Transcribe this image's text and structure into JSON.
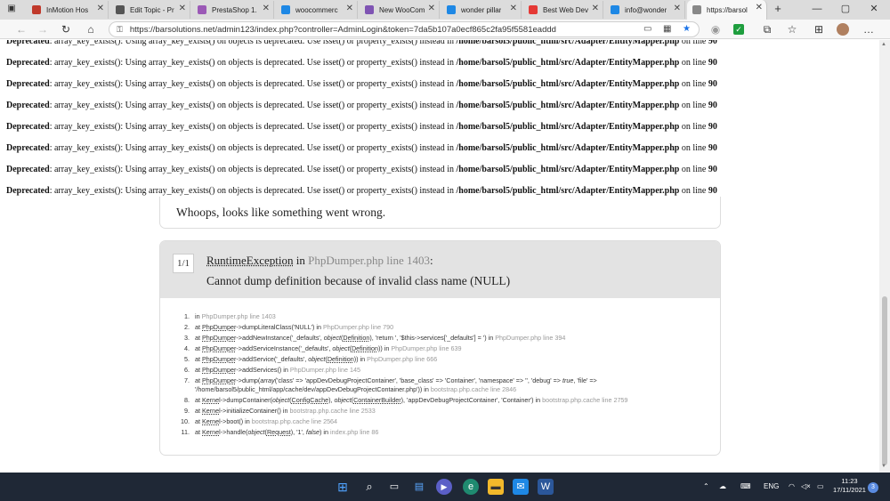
{
  "tabs": [
    {
      "title": "InMotion Hos",
      "favicon": "inmotion-icon",
      "color": "#c0392b"
    },
    {
      "title": "Edit Topic - Pr",
      "favicon": "prestashop-icon",
      "color": "#555555"
    },
    {
      "title": "PrestaShop 1.",
      "favicon": "prestashop-icon",
      "color": "#9b59b6"
    },
    {
      "title": "woocommerc",
      "favicon": "bing-icon",
      "color": "#1e88e5"
    },
    {
      "title": "New WooCom",
      "favicon": "woocommerce-icon",
      "color": "#7f54b3"
    },
    {
      "title": "wonder pillar",
      "favicon": "bing-icon",
      "color": "#1e88e5"
    },
    {
      "title": "Best Web Dev",
      "favicon": "youtube-icon",
      "color": "#e53935"
    },
    {
      "title": "info@wonder",
      "favicon": "bing-icon",
      "color": "#1e88e5"
    },
    {
      "title": "https://barsol",
      "favicon": "page-icon",
      "color": "#888888"
    }
  ],
  "address_url": "https://barsolutions.net/admin123/index.php?controller=AdminLogin&token=7da5b107a0ecf865c2fa95f5581eaddd",
  "deprecated": {
    "label": "Deprecated",
    "message": ": array_key_exists(): Using array_key_exists() on objects is deprecated. Use isset() or property_exists() instead in ",
    "file": "/home/barsol5/public_html/src/Adapter/EntityMapper.php",
    "on_line": " on line ",
    "line": "90"
  },
  "whoops": "Whoops, looks like something went wrong.",
  "exception": {
    "badge": "1/1",
    "class": "RuntimeException",
    "in": " in ",
    "file": "PhpDumper.php line 1403",
    "colon": ":",
    "message": "Cannot dump definition because of invalid class name (NULL)"
  },
  "trace": [
    {
      "n": "1.",
      "parts": [
        [
          "t",
          "in "
        ],
        [
          "g",
          "PhpDumper.php line 1403"
        ]
      ]
    },
    {
      "n": "2.",
      "parts": [
        [
          "t",
          "at "
        ],
        [
          "u",
          "PhpDumper"
        ],
        [
          "t",
          "->dumpLiteralClass('NULL') in "
        ],
        [
          "g",
          "PhpDumper.php line 790"
        ]
      ]
    },
    {
      "n": "3.",
      "parts": [
        [
          "t",
          "at "
        ],
        [
          "u",
          "PhpDumper"
        ],
        [
          "t",
          "->addNewInstance('_defaults', "
        ],
        [
          "i",
          "object"
        ],
        [
          "t",
          "("
        ],
        [
          "u",
          "Definition"
        ],
        [
          "t",
          "), 'return ', '$this->services['_defaults'] = ') in "
        ],
        [
          "g",
          "PhpDumper.php line 394"
        ]
      ]
    },
    {
      "n": "4.",
      "parts": [
        [
          "t",
          "at "
        ],
        [
          "u",
          "PhpDumper"
        ],
        [
          "t",
          "->addServiceInstance('_defaults', "
        ],
        [
          "i",
          "object"
        ],
        [
          "t",
          "("
        ],
        [
          "u",
          "Definition"
        ],
        [
          "t",
          ")) in "
        ],
        [
          "g",
          "PhpDumper.php line 639"
        ]
      ]
    },
    {
      "n": "5.",
      "parts": [
        [
          "t",
          "at "
        ],
        [
          "u",
          "PhpDumper"
        ],
        [
          "t",
          "->addService('_defaults', "
        ],
        [
          "i",
          "object"
        ],
        [
          "t",
          "("
        ],
        [
          "u",
          "Definition"
        ],
        [
          "t",
          ")) in "
        ],
        [
          "g",
          "PhpDumper.php line 666"
        ]
      ]
    },
    {
      "n": "6.",
      "parts": [
        [
          "t",
          "at "
        ],
        [
          "u",
          "PhpDumper"
        ],
        [
          "t",
          "->addServices() in "
        ],
        [
          "g",
          "PhpDumper.php line 145"
        ]
      ]
    },
    {
      "n": "7.",
      "parts": [
        [
          "t",
          "at "
        ],
        [
          "u",
          "PhpDumper"
        ],
        [
          "t",
          "->dump("
        ],
        [
          "i",
          "array"
        ],
        [
          "t",
          "('class' => 'appDevDebugProjectContainer', 'base_class' => 'Container', 'namespace' => '', 'debug' => "
        ],
        [
          "i",
          "true"
        ],
        [
          "t",
          ", 'file' => '/home/barsol5/public_html/app/cache/dev/appDevDebugProjectContainer.php')) in "
        ],
        [
          "g",
          "bootstrap.php.cache line 2846"
        ]
      ]
    },
    {
      "n": "8.",
      "parts": [
        [
          "t",
          "at "
        ],
        [
          "u",
          "Kernel"
        ],
        [
          "t",
          "->dumpContainer("
        ],
        [
          "i",
          "object"
        ],
        [
          "t",
          "("
        ],
        [
          "u",
          "ConfigCache"
        ],
        [
          "t",
          "), "
        ],
        [
          "i",
          "object"
        ],
        [
          "t",
          "("
        ],
        [
          "u",
          "ContainerBuilder"
        ],
        [
          "t",
          "), 'appDevDebugProjectContainer', 'Container') in "
        ],
        [
          "g",
          "bootstrap.php.cache line 2759"
        ]
      ]
    },
    {
      "n": "9.",
      "parts": [
        [
          "t",
          "at "
        ],
        [
          "u",
          "Kernel"
        ],
        [
          "t",
          "->initializeContainer() in "
        ],
        [
          "g",
          "bootstrap.php.cache line 2533"
        ]
      ]
    },
    {
      "n": "10.",
      "parts": [
        [
          "t",
          "at "
        ],
        [
          "u",
          "Kernel"
        ],
        [
          "t",
          "->boot() in "
        ],
        [
          "g",
          "bootstrap.php.cache line 2564"
        ]
      ]
    },
    {
      "n": "11.",
      "parts": [
        [
          "t",
          "at "
        ],
        [
          "u",
          "Kernel"
        ],
        [
          "t",
          "->handle("
        ],
        [
          "i",
          "object"
        ],
        [
          "t",
          "("
        ],
        [
          "u",
          "Request"
        ],
        [
          "t",
          "), '1', "
        ],
        [
          "i",
          "false"
        ],
        [
          "t",
          ") in "
        ],
        [
          "g",
          "index.php line 86"
        ]
      ]
    }
  ],
  "taskbar": {
    "lang": "ENG",
    "time": "11:23",
    "date": "17/11/2021",
    "notifications": "3"
  },
  "icons": {
    "back": "←",
    "forward": "→",
    "refresh": "↻",
    "home": "⌂",
    "lock": "🔒",
    "star": "★",
    "menu": "…",
    "newtab": "+",
    "minimize": "—",
    "maximize": "▢",
    "close": "✕",
    "tabclose": "✕"
  }
}
